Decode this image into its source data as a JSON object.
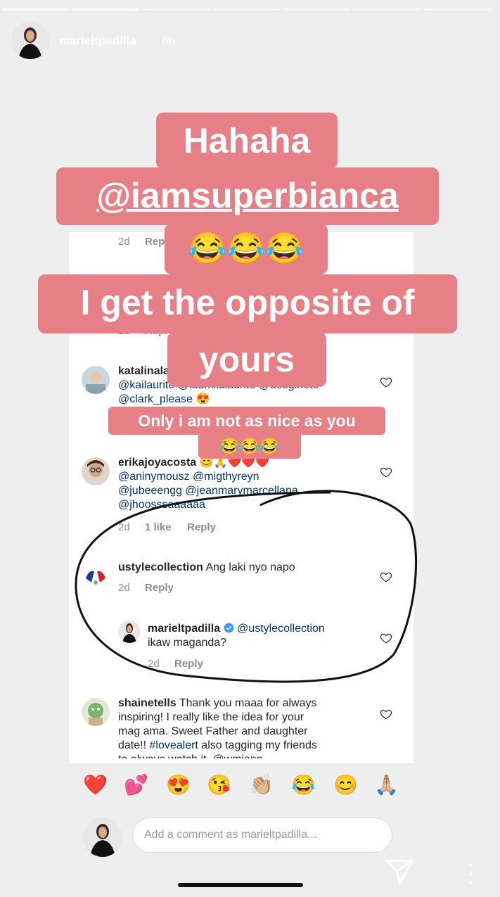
{
  "story": {
    "username": "marieltpadilla",
    "time": "8h",
    "progress_segments": 7,
    "progress_done": 1
  },
  "stickers": {
    "line1": "Hahaha",
    "line2": "@iamsuperbianca",
    "line3_emoji": "😂😂😂",
    "line4": "I get the opposite of",
    "line5": "yours",
    "small1": "Only i am not as nice as you",
    "small2_emoji": "😂😂😂"
  },
  "comments": {
    "partial_top_meta": "2d",
    "partial_top_reply": "Reply",
    "partial_second_meta": "2d",
    "partial_second_reply": "Reply",
    "katalina": {
      "username": "katalinala",
      "line1": "@kailaurito @ludmilalaurito @desginete",
      "line2": "@clark_please 😍"
    },
    "erika": {
      "username": "erikajoyacosta",
      "emoji": "😊🙏❤️❤️❤️",
      "line1": "@aninymousz @migthyreyn",
      "line2": "@jubeeengg @jeanmarymarcellana",
      "line3": "@jhoosssaaaaaa",
      "time": "2d",
      "likes": "1 like",
      "reply": "Reply"
    },
    "ustyle": {
      "username": "ustylecollection",
      "text": "Ang laki nyo napo",
      "time": "2d",
      "reply": "Reply"
    },
    "mariel_reply": {
      "username": "marieltpadilla",
      "mention": "@ustylecollection",
      "text": "ikaw maganda?",
      "time": "2d",
      "reply": "Reply"
    },
    "shaine": {
      "username": "shainetells",
      "line1": "Thank you maaa for always",
      "line2": "inspiring! I really like the idea for your",
      "line3": "mag ama. Sweet Father and daughter",
      "line4_a": "date!!",
      "line4_tag": "#lovealert",
      "line4_b": "also tagging my friends",
      "line5": "to always watch it. @wmiann"
    }
  },
  "emoji_row": [
    "❤️",
    "💕",
    "😍",
    "😘",
    "👏🏼",
    "😂",
    "😊",
    "🙏🏼"
  ],
  "compose": {
    "placeholder": "Add a comment as marieltpadilla..."
  },
  "colors": {
    "sticker_bg": "#e67f86",
    "verified_blue": "#3897f0",
    "heart_red": "#ed4956"
  }
}
